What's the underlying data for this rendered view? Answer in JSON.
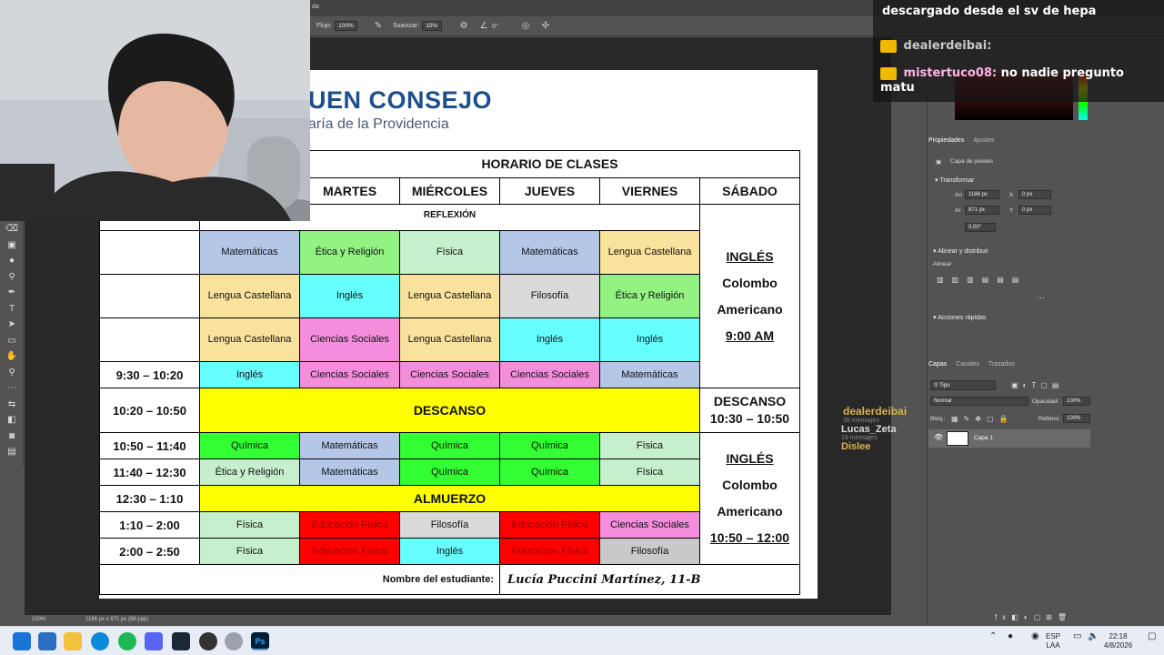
{
  "photoshop": {
    "title_fragment": "da",
    "options": {
      "flujo_label": "Flujo:",
      "flujo_value": "100%",
      "suavizar_label": "Suavizar:",
      "suavizar_value": "10%",
      "angle_value": "0°"
    },
    "status_zoom": "100%",
    "status_size": "1186 px x 871 px (96 ppp)",
    "properties": {
      "tab_active": "Propiedades",
      "tab_other": "Ajustes",
      "pixel_layer": "Capa de píxeles",
      "transform_title": "Transformar",
      "an_label": "An",
      "an_value": "1186 px",
      "al_label": "Al",
      "al_value": "871 px",
      "x_label": "X",
      "x_value": "0 px",
      "y_label": "Y",
      "y_value": "0 px",
      "angle_value": "0,00°",
      "align_title": "Alinear y distribuir",
      "align_label": "Alinear:",
      "quick_actions": "Acciones rápidas"
    },
    "layers": {
      "tabs": [
        "Capas",
        "Canales",
        "Trazados"
      ],
      "filter": "Tipo",
      "blend_mode": "Normal",
      "opacity_label": "Opacidad:",
      "opacity_value": "100%",
      "lock_label": "Bloq.:",
      "fill_label": "Relleno:",
      "fill_value": "100%",
      "layer_name": "Capa 1"
    }
  },
  "document": {
    "logo_line1": "UEN CONSEJO",
    "logo_line2": "aría de la Providencia",
    "schedule_title": "HORARIO DE CLASES",
    "days": [
      "MARTES",
      "MIÉRCOLES",
      "JUEVES",
      "VIERNES",
      "SÁBADO"
    ],
    "reflexion": "REFLEXIÓN",
    "rows": [
      {
        "time": "",
        "cells": [
          "Matemáticas",
          "Ética y Religión",
          "Física",
          "Matemáticas",
          "Lengua Castellana"
        ]
      },
      {
        "time": "",
        "cells": [
          "Lengua Castellana",
          "Inglés",
          "Lengua Castellana",
          "Filosofía",
          "Ética y Religión"
        ]
      },
      {
        "time": "",
        "cells": [
          "Lengua Castellana",
          "Ciencias Sociales",
          "Lengua Castellana",
          "Inglés",
          "Inglés"
        ]
      },
      {
        "time": "9:30 – 10:20",
        "cells": [
          "Inglés",
          "Ciencias Sociales",
          "Ciencias Sociales",
          "Ciencias Sociales",
          "Matemáticas"
        ]
      }
    ],
    "break1_time": "10:20 – 10:50",
    "break1_label": "DESCANSO",
    "sat_break_line1": "DESCANSO",
    "sat_break_line2": "10:30 – 10:50",
    "rows2": [
      {
        "time": "10:50 – 11:40",
        "cells": [
          "Química",
          "Matemáticas",
          "Química",
          "Química",
          "Física"
        ]
      },
      {
        "time": "11:40 – 12:30",
        "cells": [
          "Ética y Religión",
          "Matemáticas",
          "Química",
          "Química",
          "Física"
        ]
      }
    ],
    "lunch_time": "12:30 – 1:10",
    "lunch_label": "ALMUERZO",
    "rows3": [
      {
        "time": "1:10 – 2:00",
        "cells": [
          "Física",
          "Educación Física",
          "Filosofía",
          "Educación Física",
          "Ciencias Sociales"
        ]
      },
      {
        "time": "2:00 – 2:50",
        "cells": [
          "Física",
          "Educación Física",
          "Inglés",
          "Educación Física",
          "Filosofía"
        ]
      }
    ],
    "sat1": {
      "subject": "INGLÉS",
      "line2": "Colombo",
      "line3": "Americano",
      "time": "9:00 AM"
    },
    "sat2": {
      "subject": "INGLÉS",
      "line2": "Colombo",
      "line3": "Americano",
      "time": "10:50 – 12:00"
    },
    "student_label": "Nombre del estudiante:",
    "student_name": "Lucía Puccini Martínez, 11-B"
  },
  "chat": {
    "line1": "descargado desde el sv de hepa",
    "line2_user": "dealerdeibai:",
    "line3_user": "mistertuco08:",
    "line3_text": "no nadie pregunto",
    "line3_cont": "matu",
    "side_name1": "dealerdeibai",
    "side_sub1": "35 mensajes",
    "side_name2": "Lucas_Zeta",
    "side_sub2": "19 mensajes",
    "side_name3": "Dislee"
  },
  "taskbar": {
    "lang1": "ESP",
    "lang2": "LAA",
    "time": "22:18",
    "date": "4/8/2026"
  }
}
